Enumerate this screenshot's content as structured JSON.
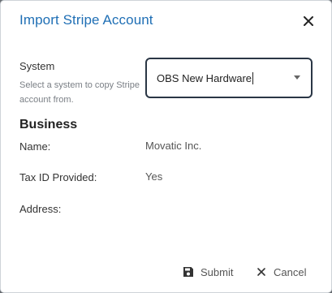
{
  "dialog": {
    "title": "Import Stripe Account"
  },
  "system": {
    "label": "System",
    "help_text": "Select a system to copy Stripe account from.",
    "selected_value": "OBS New Hardware"
  },
  "business": {
    "heading": "Business",
    "name_label": "Name:",
    "name_value": "Movatic Inc.",
    "tax_label": "Tax ID Provided:",
    "tax_value": "Yes",
    "address_label": "Address:",
    "address_value": ""
  },
  "footer": {
    "submit_label": "Submit",
    "cancel_label": "Cancel"
  },
  "icons": {
    "close": "close-icon",
    "dropdown": "caret-down-icon",
    "submit": "save-icon",
    "cancel": "close-icon"
  },
  "colors": {
    "title": "#1f6fb5",
    "select_border": "#2a3645"
  }
}
